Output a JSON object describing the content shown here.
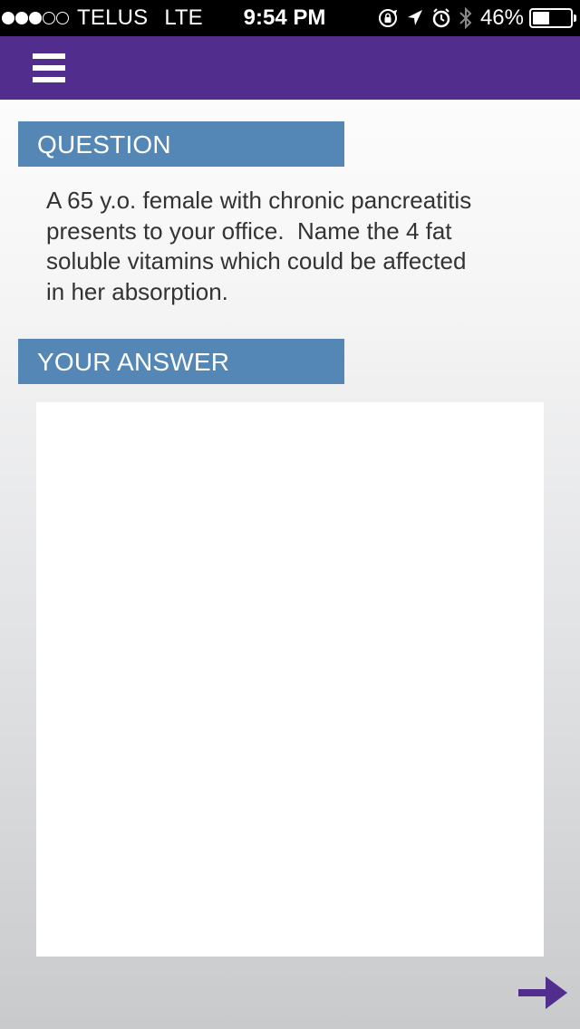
{
  "status_bar": {
    "signal_dots": [
      "full",
      "full",
      "full",
      "empty",
      "empty"
    ],
    "carrier": "TELUS",
    "network": "LTE",
    "time": "9:54 PM",
    "battery_percent": "46%",
    "battery_level": 0.46,
    "icons": [
      "orientation-lock-icon",
      "location-arrow-icon",
      "alarm-clock-icon",
      "bluetooth-icon"
    ]
  },
  "nav": {
    "menu_icon": "hamburger-menu-icon"
  },
  "question": {
    "header": "QUESTION",
    "text": "A 65 y.o. female with chronic pancreatitis\npresents to your office.  Name the 4 fat\nsoluble vitamins which could be affected\nin her absorption."
  },
  "answer": {
    "header": "YOUR ANSWER",
    "value": ""
  },
  "footer": {
    "next_icon": "arrow-right-icon"
  },
  "colors": {
    "nav_background": "#512e8e",
    "section_header": "#5487b5",
    "next_arrow": "#512e8e",
    "body_text": "#333333"
  }
}
